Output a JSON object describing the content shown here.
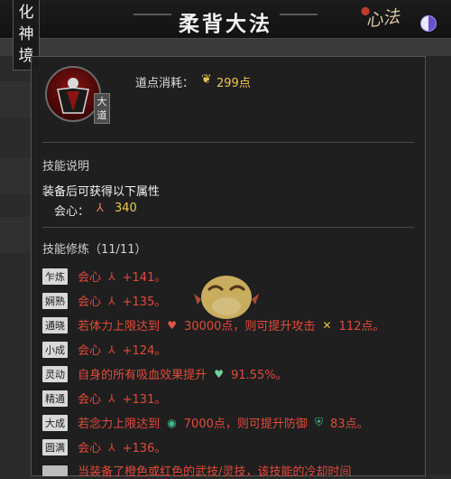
{
  "header": {
    "realm": "化神境",
    "title": "柔背大法",
    "xinfa": "心法"
  },
  "skill": {
    "tag": "大道",
    "cost_label": "道点消耗：",
    "cost_value": "299点"
  },
  "description": {
    "title": "技能说明",
    "text": "装备后可获得以下属性",
    "stat_label": "会心：",
    "stat_value": "340"
  },
  "training": {
    "title": "技能修炼（11/11）",
    "rows": [
      {
        "badge": "乍炼",
        "text": "会心",
        "value": "+141。"
      },
      {
        "badge": "娴熟",
        "text": "会心",
        "value": "+135。"
      },
      {
        "badge": "通晓",
        "text1": "若体力上限达到",
        "v1": "30000点，则可提升攻击",
        "v2": "112点。"
      },
      {
        "badge": "小成",
        "text": "会心",
        "value": "+124。"
      },
      {
        "badge": "灵动",
        "text1": "自身的所有吸血效果提升",
        "v1": "91.55%。"
      },
      {
        "badge": "精通",
        "text": "会心",
        "value": "+131。"
      },
      {
        "badge": "大成",
        "text1": "若念力上限达到",
        "v1": "7000点，则可提升防御",
        "v2": "83点。"
      },
      {
        "badge": "圆满",
        "text": "会心",
        "value": "+136。"
      },
      {
        "badge": "",
        "text1": "当装备了橙色或红色的武技/灵技，该技能的冷却时间"
      }
    ]
  },
  "colors": {
    "accent_gold": "#f0c94a",
    "effect_red": "#e24a3c",
    "panel_bg": "#1e1e1e"
  }
}
